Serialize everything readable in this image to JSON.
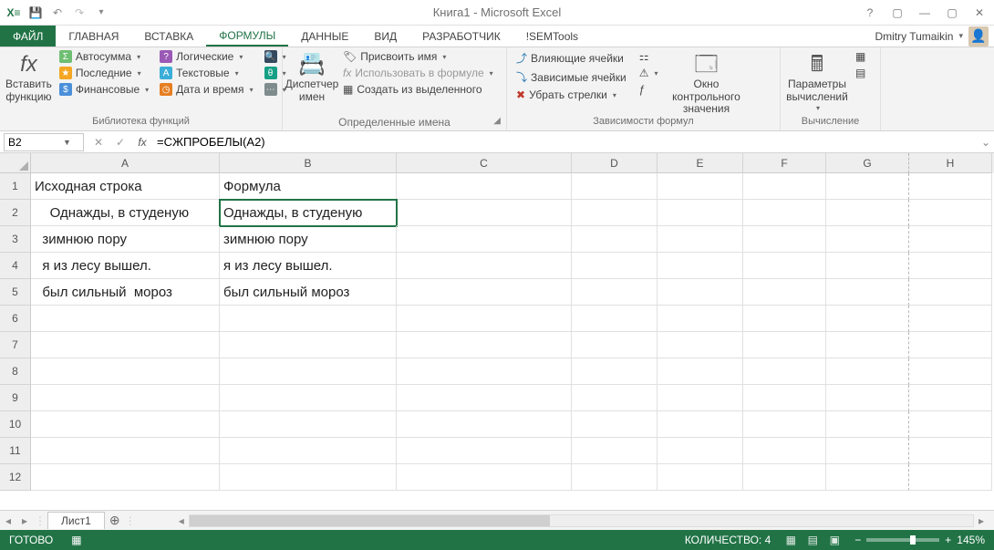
{
  "title": "Книга1 - Microsoft Excel",
  "user": "Dmitry Tumaikin",
  "tabs": [
    "ФАЙЛ",
    "ГЛАВНАЯ",
    "ВСТАВКА",
    "ФОРМУЛЫ",
    "ДАННЫЕ",
    "ВИД",
    "РАЗРАБОТЧИК",
    "!SEMTools"
  ],
  "active_tab": "ФОРМУЛЫ",
  "ribbon": {
    "g1": {
      "label": "Библиотека функций",
      "big": "Вставить\nфункцию",
      "c1": [
        "Автосумма",
        "Последние",
        "Финансовые"
      ],
      "c2": [
        "Логические",
        "Текстовые",
        "Дата и время"
      ]
    },
    "g2": {
      "label": "Определенные имена",
      "big": "Диспетчер\nимен",
      "items": [
        "Присвоить имя",
        "Использовать в формуле",
        "Создать из выделенного"
      ]
    },
    "g3": {
      "label": "Зависимости формул",
      "items": [
        "Влияющие ячейки",
        "Зависимые ячейки",
        "Убрать стрелки"
      ],
      "big": "Окно контрольного\nзначения"
    },
    "g4": {
      "label": "Вычисление",
      "big": "Параметры\nвычислений"
    }
  },
  "namebox": "B2",
  "formula": "=СЖПРОБЕЛЫ(A2)",
  "columns": [
    "A",
    "B",
    "C",
    "D",
    "E",
    "F",
    "G",
    "H"
  ],
  "rows": [
    {
      "n": "1",
      "a": "Исходная строка",
      "b": "Формула"
    },
    {
      "n": "2",
      "a": "    Однажды, в студеную",
      "b": "Однажды, в студеную"
    },
    {
      "n": "3",
      "a": "  зимнюю пору",
      "b": "зимнюю пору"
    },
    {
      "n": "4",
      "a": "  я из лесу вышел.",
      "b": "я из лесу вышел."
    },
    {
      "n": "5",
      "a": "  был сильный  мороз",
      "b": "был сильный мороз"
    },
    {
      "n": "6",
      "a": "",
      "b": ""
    },
    {
      "n": "7",
      "a": "",
      "b": ""
    },
    {
      "n": "8",
      "a": "",
      "b": ""
    },
    {
      "n": "9",
      "a": "",
      "b": ""
    },
    {
      "n": "10",
      "a": "",
      "b": ""
    },
    {
      "n": "11",
      "a": "",
      "b": ""
    },
    {
      "n": "12",
      "a": "",
      "b": ""
    }
  ],
  "sheet": "Лист1",
  "status": {
    "ready": "ГОТОВО",
    "count": "КОЛИЧЕСТВО: 4",
    "zoom": "145%"
  }
}
